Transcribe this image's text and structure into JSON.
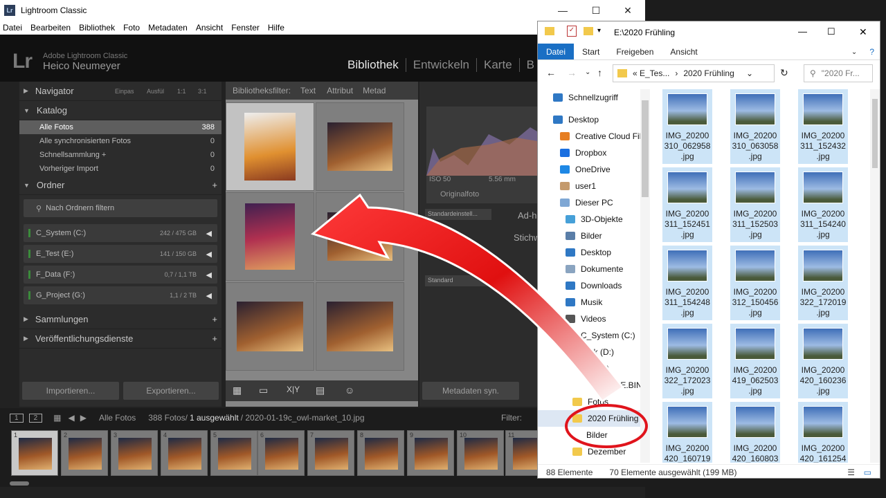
{
  "lightroom": {
    "window_title": "Lightroom Classic",
    "menu": [
      "Datei",
      "Bearbeiten",
      "Bibliothek",
      "Foto",
      "Metadaten",
      "Ansicht",
      "Fenster",
      "Hilfe"
    ],
    "product": "Adobe Lightroom Classic",
    "user": "Heico Neumeyer",
    "modules": [
      "Bibliothek",
      "Entwickeln",
      "Karte",
      "B"
    ],
    "navigator": {
      "label": "Navigator",
      "zoom": [
        "Einpas",
        "Ausfül",
        "1:1",
        "3:1"
      ]
    },
    "catalog": {
      "label": "Katalog",
      "items": [
        {
          "label": "Alle Fotos",
          "count": "388"
        },
        {
          "label": "Alle synchronisierten Fotos",
          "count": "0"
        },
        {
          "label": "Schnellsammlung  +",
          "count": "0"
        },
        {
          "label": "Vorheriger Import",
          "count": "0"
        }
      ]
    },
    "folders": {
      "label": "Ordner",
      "filter": "Nach Ordnern filtern",
      "volumes": [
        {
          "name": "C_System (C:)",
          "size": "242 / 475 GB"
        },
        {
          "name": "E_Test (E:)",
          "size": "141 / 150 GB"
        },
        {
          "name": "F_Data (F:)",
          "size": "0,7 / 1,1 TB"
        },
        {
          "name": "G_Project (G:)",
          "size": "1,1 / 2 TB"
        }
      ]
    },
    "collections": "Sammlungen",
    "publish": "Veröffentlichungsdienste",
    "import_btn": "Importieren...",
    "export_btn": "Exportieren...",
    "filter_bar": {
      "label": "Bibliotheksfilter:",
      "opts": [
        "Text",
        "Attribut",
        "Metad"
      ]
    },
    "histogram": {
      "iso": "ISO 50",
      "focal": "5.56 mm",
      "orig": "Originalfoto"
    },
    "quick_dev": {
      "preset": "Standardeinstell...",
      "adhoc": "Ad-h",
      "keyword": "Stichw",
      "standard": "Standard"
    },
    "meta_sync": "Metadaten syn.",
    "film_header": {
      "source": "Alle Fotos",
      "count": "388 Fotos/",
      "selected": "1 ausgewählt",
      "file": "/ 2020-01-19c_owl-market_10.jpg",
      "filter": "Filter:"
    },
    "film_numbers": [
      "1",
      "2",
      "3",
      "4",
      "5",
      "6",
      "7",
      "8",
      "9",
      "10",
      "11"
    ]
  },
  "explorer": {
    "title": "E:\\2020 Frühling",
    "ribbon": [
      "Datei",
      "Start",
      "Freigeben",
      "Ansicht"
    ],
    "address": [
      "«  E_Tes...",
      "2020 Frühling"
    ],
    "search": "\"2020 Fr...",
    "nav": [
      "Schnellzugriff",
      "Desktop",
      "Creative Cloud Fil",
      "Dropbox",
      "OneDrive",
      "user1",
      "Dieser PC",
      "3D-Objekte",
      "Bilder",
      "Desktop",
      "Dokumente",
      "Downloads",
      "Musik",
      "Videos",
      "C_System (C:)",
      "ak (D:)",
      ":)",
      "CLE.BIN",
      "Fotos",
      "2020 Frühling",
      "Bilder",
      "Dezember"
    ],
    "files": [
      [
        "IMG_20200",
        "310_062958",
        ".jpg"
      ],
      [
        "IMG_20200",
        "310_063058",
        ".jpg"
      ],
      [
        "IMG_20200",
        "311_152432",
        ".jpg"
      ],
      [
        "IMG_20200",
        "311_152451",
        ".jpg"
      ],
      [
        "IMG_20200",
        "311_152503",
        ".jpg"
      ],
      [
        "IMG_20200",
        "311_154240",
        ".jpg"
      ],
      [
        "IMG_20200",
        "311_154248",
        ".jpg"
      ],
      [
        "IMG_20200",
        "312_150456",
        ".jpg"
      ],
      [
        "IMG_20200",
        "322_172019",
        ".jpg"
      ],
      [
        "IMG_20200",
        "322_172023",
        ".jpg"
      ],
      [
        "IMG_20200",
        "419_062503",
        ".jpg"
      ],
      [
        "IMG_20200",
        "420_160236",
        ".jpg"
      ],
      [
        "IMG_20200",
        "420_160719",
        ".jpg"
      ],
      [
        "IMG_20200",
        "420_160803",
        ".jpg"
      ],
      [
        "IMG_20200",
        "420_161254",
        ".jpg"
      ]
    ],
    "status_count": "88 Elemente",
    "status_sel": "70 Elemente ausgewählt (199 MB)"
  }
}
